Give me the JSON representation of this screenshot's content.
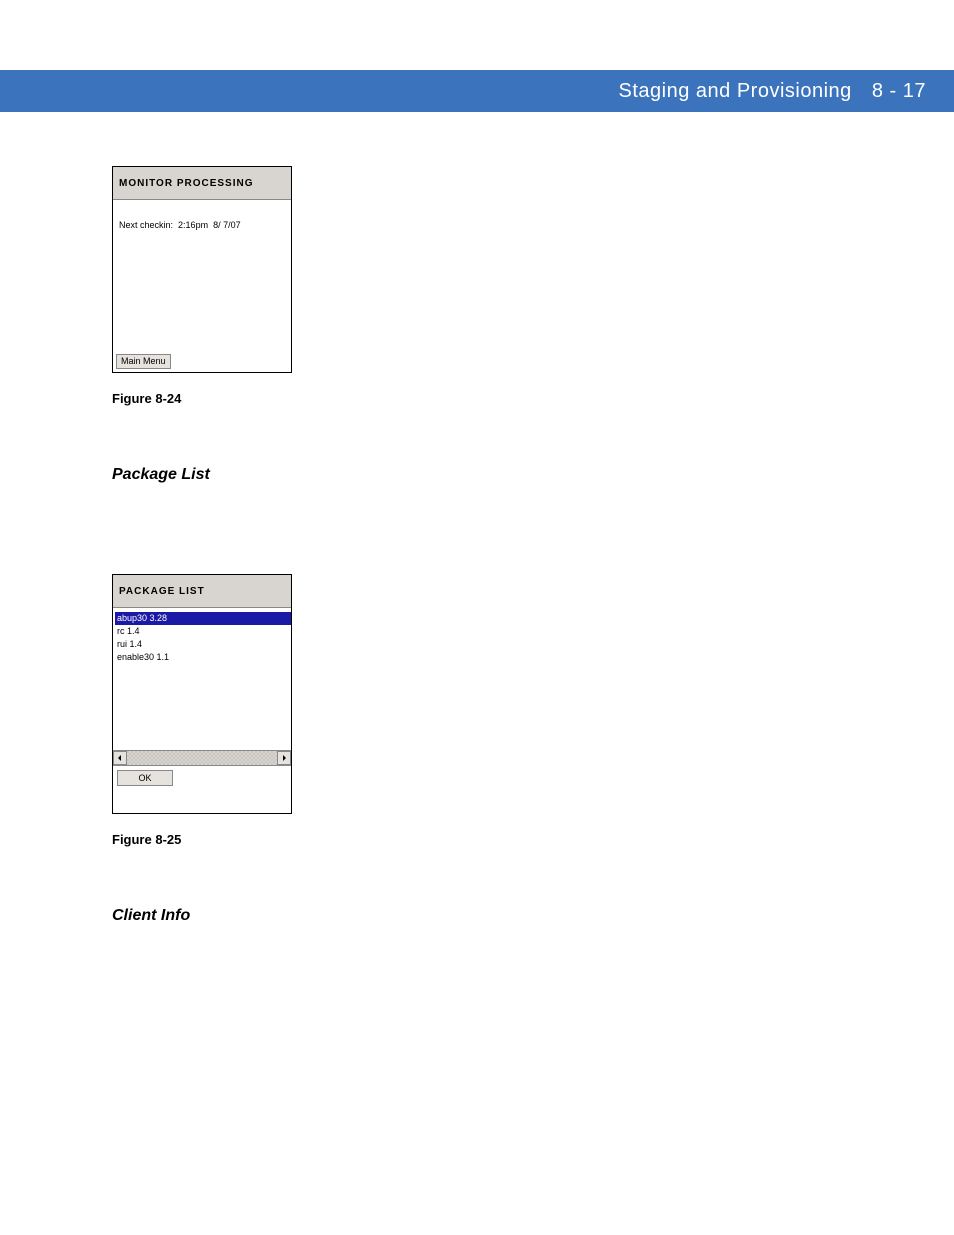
{
  "header": {
    "title": "Staging and Provisioning",
    "page": "8 - 17"
  },
  "monitor_window": {
    "title": "MONITOR PROCESSING",
    "next_checkin_label": "Next checkin:",
    "next_checkin_time": "2:16pm",
    "next_checkin_date": "8/ 7/07",
    "main_menu_label": "Main Menu"
  },
  "figure24_caption": "Figure 8-24",
  "section_package_list": "Package List",
  "package_window": {
    "title": "PACKAGE LIST",
    "items": [
      "abup30 3.28",
      "rc 1.4",
      "rui 1.4",
      "enable30 1.1"
    ],
    "ok_label": "OK"
  },
  "figure25_caption": "Figure 8-25",
  "section_client_info": "Client Info"
}
